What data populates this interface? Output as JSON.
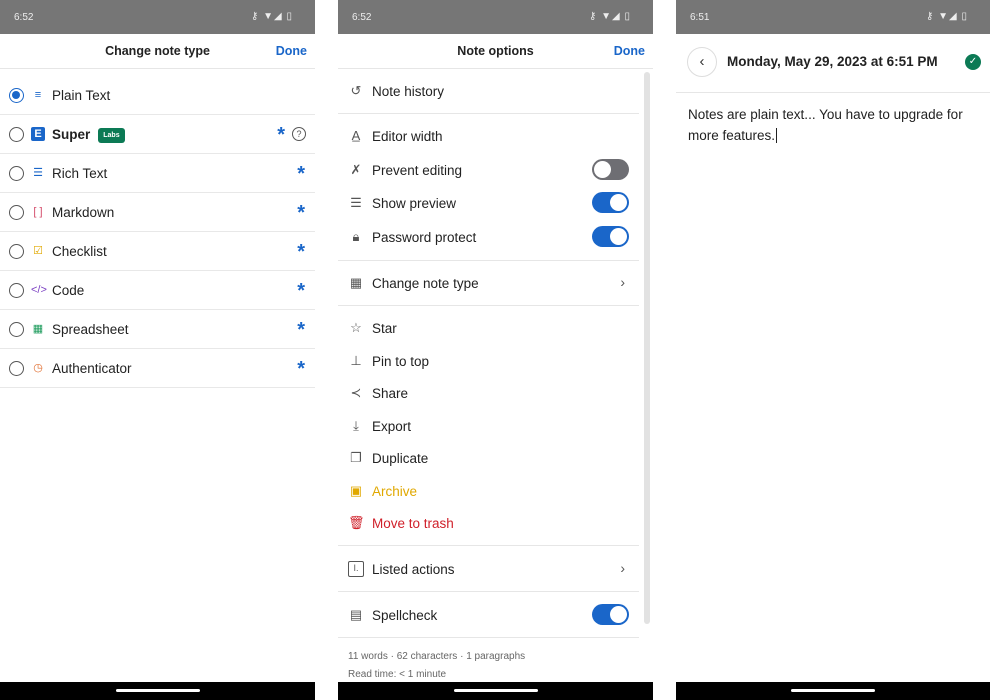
{
  "panels": [
    {
      "status_time": "6:52",
      "status_icons": "⚷ ▼◢ ▯"
    },
    {
      "status_time": "6:52",
      "status_icons": "⚷ ▼◢ ▯"
    },
    {
      "status_time": "6:51",
      "status_icons": "⚷ ▼◢ ▯"
    }
  ],
  "change_type": {
    "title": "Change note type",
    "done": "Done",
    "items": [
      {
        "label": "Plain Text",
        "selected": true,
        "icon": "≡",
        "color": "#1a66c9"
      },
      {
        "label": "Super",
        "badge": "Labs",
        "icon": "E",
        "color": "#1a66c9"
      },
      {
        "label": "Rich Text",
        "icon": "☰",
        "color": "#1a66c9"
      },
      {
        "label": "Markdown",
        "icon": "[ ]",
        "color": "#d44b6a"
      },
      {
        "label": "Checklist",
        "icon": "☑",
        "color": "#e0a800"
      },
      {
        "label": "Code",
        "icon": "</>",
        "color": "#7a3fc2"
      },
      {
        "label": "Spreadsheet",
        "icon": "▦",
        "color": "#1a9a5a"
      },
      {
        "label": "Authenticator",
        "icon": "◷",
        "color": "#e06a2a"
      }
    ],
    "premium_mark": "*",
    "help": "?"
  },
  "options": {
    "title": "Note options",
    "done": "Done",
    "items": {
      "history": "Note history",
      "editor_width": "Editor width",
      "prevent_editing": "Prevent editing",
      "show_preview": "Show preview",
      "password": "Password protect",
      "change_type": "Change note type",
      "star": "Star",
      "pin": "Pin to top",
      "share": "Share",
      "export": "Export",
      "duplicate": "Duplicate",
      "archive": "Archive",
      "trash": "Move to trash",
      "listed": "Listed actions",
      "spellcheck": "Spellcheck"
    },
    "toggles": {
      "prevent_editing": false,
      "show_preview": true,
      "password": true,
      "spellcheck": true
    },
    "stats": "11 words · 62 characters · 1 paragraphs",
    "read_time": "Read time: < 1 minute",
    "colors": {
      "archive": "#e0a800",
      "trash": "#d0202a",
      "accent": "#1a66c9"
    }
  },
  "editor": {
    "title": "Monday, May 29, 2023 at 6:51 PM",
    "body": "Notes are plain text... You have to upgrade for more features."
  }
}
